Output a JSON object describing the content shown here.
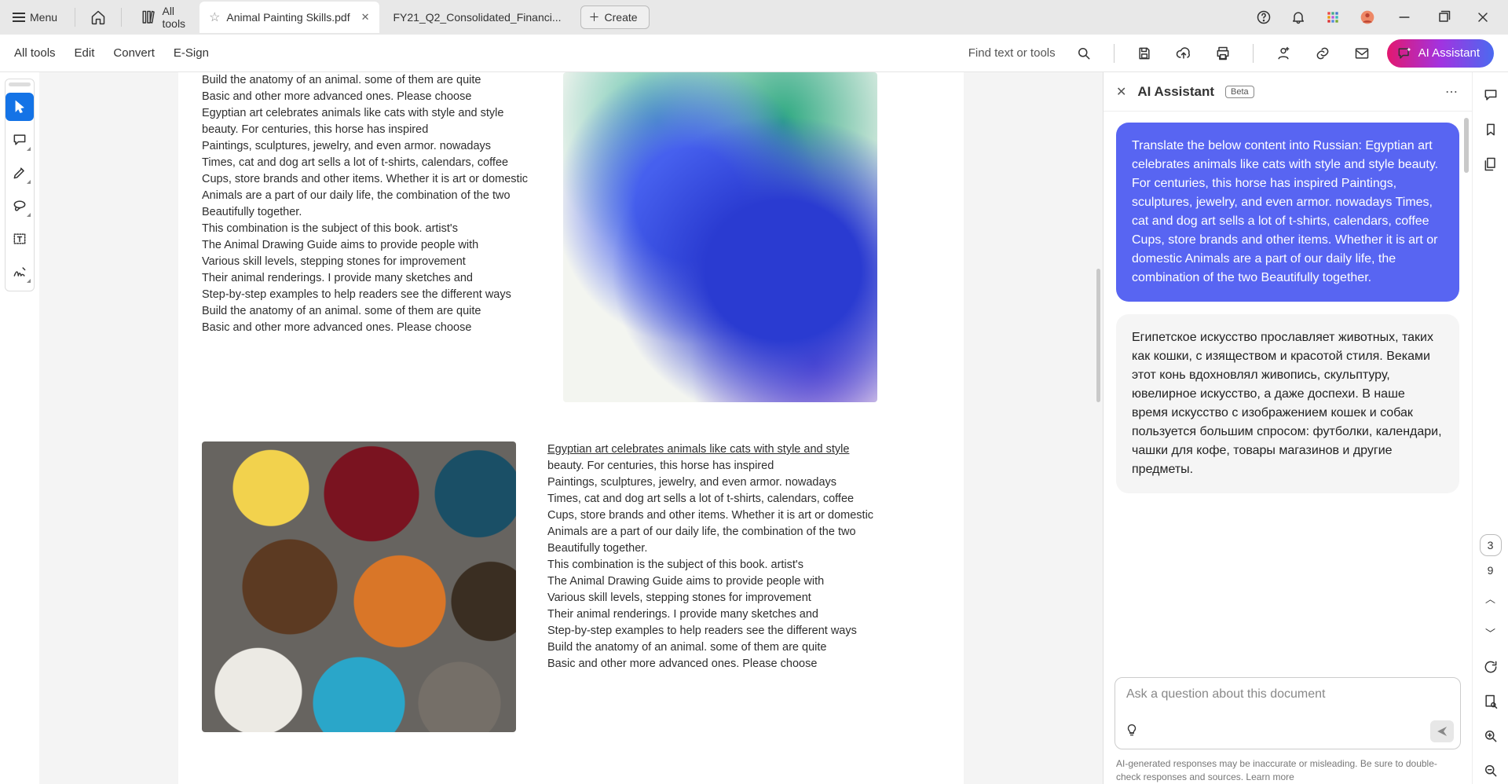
{
  "titlebar": {
    "menu_label": "Menu",
    "all_tools_label": "All tools",
    "tabs": [
      {
        "label": "Animal Painting Skills.pdf",
        "active": true
      },
      {
        "label": "FY21_Q2_Consolidated_Financi...",
        "active": false
      }
    ],
    "create_label": "Create"
  },
  "toolbar": {
    "all_tools": "All tools",
    "edit": "Edit",
    "convert": "Convert",
    "esign": "E-Sign",
    "find_placeholder": "Find text or tools",
    "ai_label": "AI Assistant"
  },
  "document": {
    "section1": {
      "lines": [
        "Build the anatomy of an animal. some of them are quite",
        "Basic and other more advanced ones. Please choose",
        "Egyptian art celebrates animals like cats with style and style",
        "beauty. For centuries, this horse has inspired",
        "Paintings, sculptures, jewelry, and even armor. nowadays",
        "Times, cat and dog art sells a lot of t-shirts, calendars, coffee",
        "Cups, store brands and other items. Whether it is art or domestic",
        "Animals are a part of our daily life, the combination of the two",
        "Beautifully together.",
        "This combination is the subject of this book. artist's",
        "The Animal Drawing Guide aims to provide people with",
        "Various skill levels, stepping stones for improvement",
        "Their animal renderings. I provide many sketches and",
        "Step-by-step examples to help readers see the different ways",
        "Build the anatomy of an animal. some of them are quite",
        "Basic and other more advanced ones. Please choose"
      ]
    },
    "section2": {
      "lines": [
        "Egyptian art celebrates animals like cats with style and style",
        "beauty. For centuries, this horse has inspired",
        "Paintings, sculptures, jewelry, and even armor. nowadays",
        "Times, cat and dog art sells a lot of t-shirts, calendars, coffee",
        "Cups, store brands and other items. Whether it is art or domestic",
        "Animals are a part of our daily life, the combination of the two",
        "Beautifully together.",
        "This combination is the subject of this book. artist's",
        "The Animal Drawing Guide aims to provide people with",
        "Various skill levels, stepping stones for improvement",
        "Their animal renderings. I provide many sketches and",
        "Step-by-step examples to help readers see the different ways",
        "Build the anatomy of an animal. some of them are quite",
        "Basic and other more advanced ones. Please choose"
      ]
    }
  },
  "ai_panel": {
    "title": "AI Assistant",
    "beta": "Beta",
    "user_message": "Translate the below content into Russian: Egyptian art celebrates animals like cats with style and style beauty. For centuries, this horse has inspired Paintings, sculptures, jewelry, and even armor. nowadays Times, cat and dog art sells a lot of t-shirts, calendars, coffee Cups, store brands and other items. Whether it is art or domestic Animals are a part of our daily life, the combination of the two Beautifully together.",
    "assistant_message": "Египетское искусство прославляет животных, таких как кошки, с изяществом и красотой стиля. Веками этот конь вдохновлял живопись, скульптуру, ювелирное искусство, а даже доспехи. В наше время искусство с изображением кошек и собак пользуется большим спросом: футболки, календари, чашки для кофе, товары магазинов и другие предметы.",
    "input_placeholder": "Ask a question about this document",
    "disclaimer": "AI-generated responses may be inaccurate or misleading. Be sure to double-check responses and sources. Learn more"
  },
  "right_rail": {
    "current_page": "3",
    "total_pages": "9"
  }
}
